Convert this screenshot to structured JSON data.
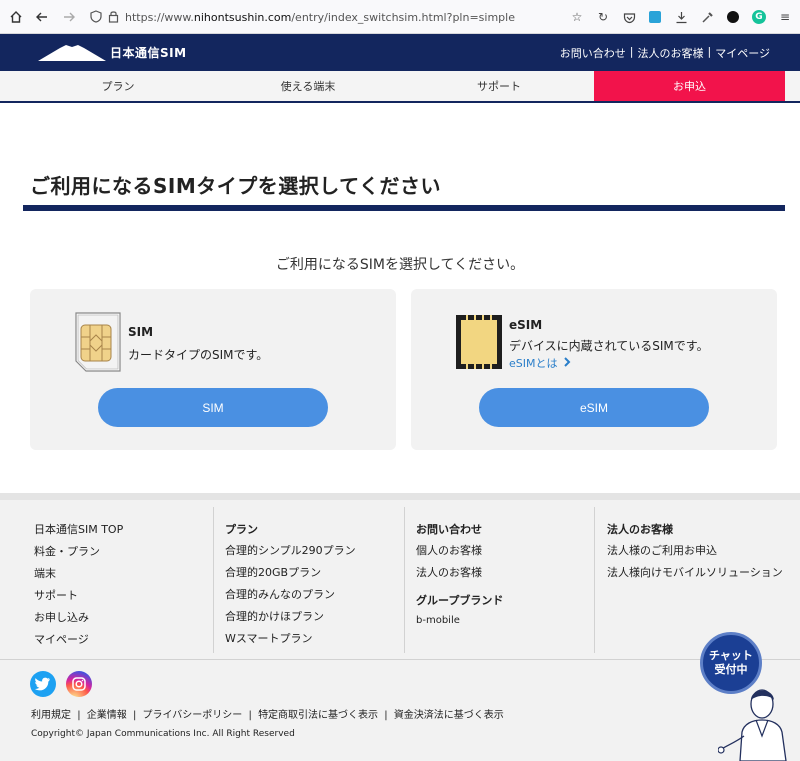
{
  "browser": {
    "url_prefix": "https://www.",
    "url_host": "nihontsushin.com",
    "url_path": "/entry/index_switchsim.html?pln=simple"
  },
  "header": {
    "logo_text": "日本通信SIM",
    "links": [
      "お問い合わせ",
      "法人のお客様",
      "マイページ"
    ],
    "separator": "|"
  },
  "nav": {
    "tabs": [
      "プラン",
      "使える端末",
      "サポート",
      "お申込"
    ]
  },
  "main": {
    "title": "ご利用になるSIMタイプを選択してください",
    "subtitle": "ご利用になるSIMを選択してください。",
    "cards": {
      "sim": {
        "name": "SIM",
        "description": "カードタイプのSIMです。",
        "button": "SIM"
      },
      "esim": {
        "name": "eSIM",
        "description": "デバイスに内蔵されているSIMです。",
        "link": "eSIMとは",
        "button": "eSIM"
      }
    }
  },
  "footer": {
    "col1": {
      "links": [
        "日本通信SIM TOP",
        "料金・プラン",
        "端末",
        "サポート",
        "お申し込み",
        "マイページ"
      ]
    },
    "col2": {
      "heading": "プラン",
      "links": [
        "合理的シンプル290プラン",
        "合理的20GBプラン",
        "合理的みんなのプラン",
        "合理的かけほプラン",
        "Wスマートプラン"
      ]
    },
    "col3": {
      "heading": "お問い合わせ",
      "links": [
        "個人のお客様",
        "法人のお客様"
      ],
      "heading2": "グループブランド",
      "links2": [
        "b-mobile"
      ]
    },
    "col4": {
      "heading": "法人のお客様",
      "links": [
        "法人様のご利用お申込",
        "法人様向けモバイルソリューション"
      ]
    },
    "legal": [
      "利用規定",
      "企業情報",
      "プライバシーポリシー",
      "特定商取引法に基づく表示",
      "資金決済法に基づく表示"
    ],
    "legal_separator": "|",
    "copyright": "Copyright© Japan Communications Inc. All Right Reserved"
  },
  "chat": {
    "line1": "チャット",
    "line2": "受付中"
  },
  "colors": {
    "brand_navy": "#13265e",
    "apply_red": "#f2134b",
    "button_blue": "#4a90e2",
    "link_blue": "#2a7ec9"
  },
  "icons": {
    "browser": [
      "home-icon",
      "back-arrow-icon",
      "forward-arrow-icon",
      "shield-icon",
      "lock-icon",
      "star-icon",
      "reload-icon",
      "save-to-pocket-icon",
      "download-icon",
      "eyedropper-icon",
      "menu-icon"
    ],
    "social": [
      "twitter-icon",
      "instagram-icon"
    ]
  }
}
